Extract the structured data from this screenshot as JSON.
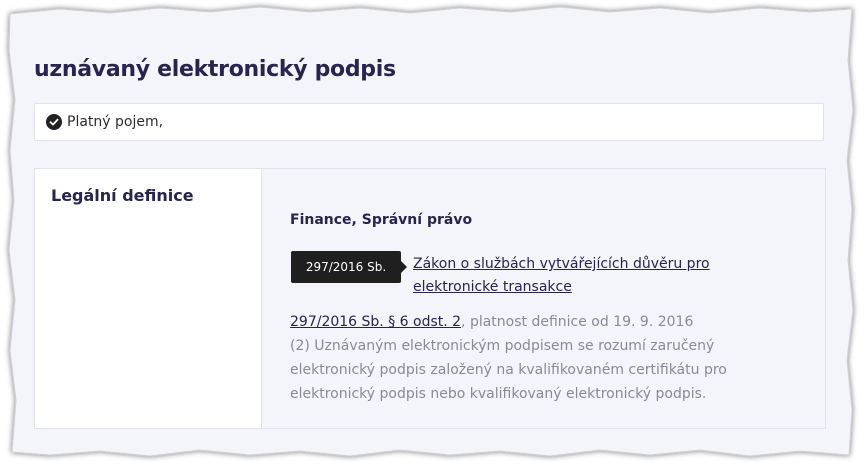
{
  "term": {
    "title": "uznávaný elektronický podpis",
    "status": "Platný pojem,"
  },
  "definition": {
    "label": "Legální definice",
    "domains": "Finance, Správní právo",
    "tooltip": "297/2016 Sb.",
    "law_title": "Zákon o službách vytvářejících důvěru pro elektronické transakce",
    "section_ref": "297/2016 Sb. § 6 odst. 2",
    "validity": ", platnost definice od 19. 9. 2016",
    "text": "(2) Uznávaným elektronickým podpisem se rozumí zaručený elektronický podpis založený na kvalifikovaném certifikátu pro elektronický podpis nebo kvalifikovaný elektronický podpis."
  },
  "icons": {
    "status": "check-circle-icon"
  },
  "colors": {
    "heading": "#27244f",
    "panel_bg": "#f4f4fb",
    "muted_text": "#8a8a96",
    "tooltip_bg": "#1f1f1f"
  }
}
